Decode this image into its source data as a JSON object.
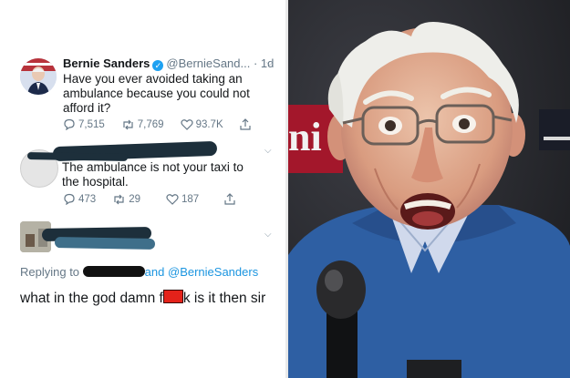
{
  "tweet1": {
    "name": "Bernie Sanders",
    "handle": "@BernieSand...",
    "time": "· 1d",
    "text": "Have you ever avoided taking an ambulance because you could not afford it?",
    "stats": {
      "replies": "7,515",
      "retweets": "7,769",
      "likes": "93.7K"
    }
  },
  "tweet2": {
    "text": "The ambulance is not your taxi to the hospital.",
    "stats": {
      "replies": "473",
      "retweets": "29",
      "likes": "187"
    }
  },
  "tweet3": {
    "replying_prefix": "Replying to",
    "replying_rest": "and",
    "replying_mention": "@BernieSanders",
    "text_before": "what in the god damn f",
    "text_after": "k is it then sir"
  },
  "colors": {
    "accent": "#1da1f2",
    "text": "#14171a",
    "muted": "#657786",
    "censor": "#e4221a"
  },
  "icons": [
    "verified-icon",
    "chevron-down-icon",
    "reply-icon",
    "retweet-icon",
    "like-icon",
    "share-icon"
  ]
}
